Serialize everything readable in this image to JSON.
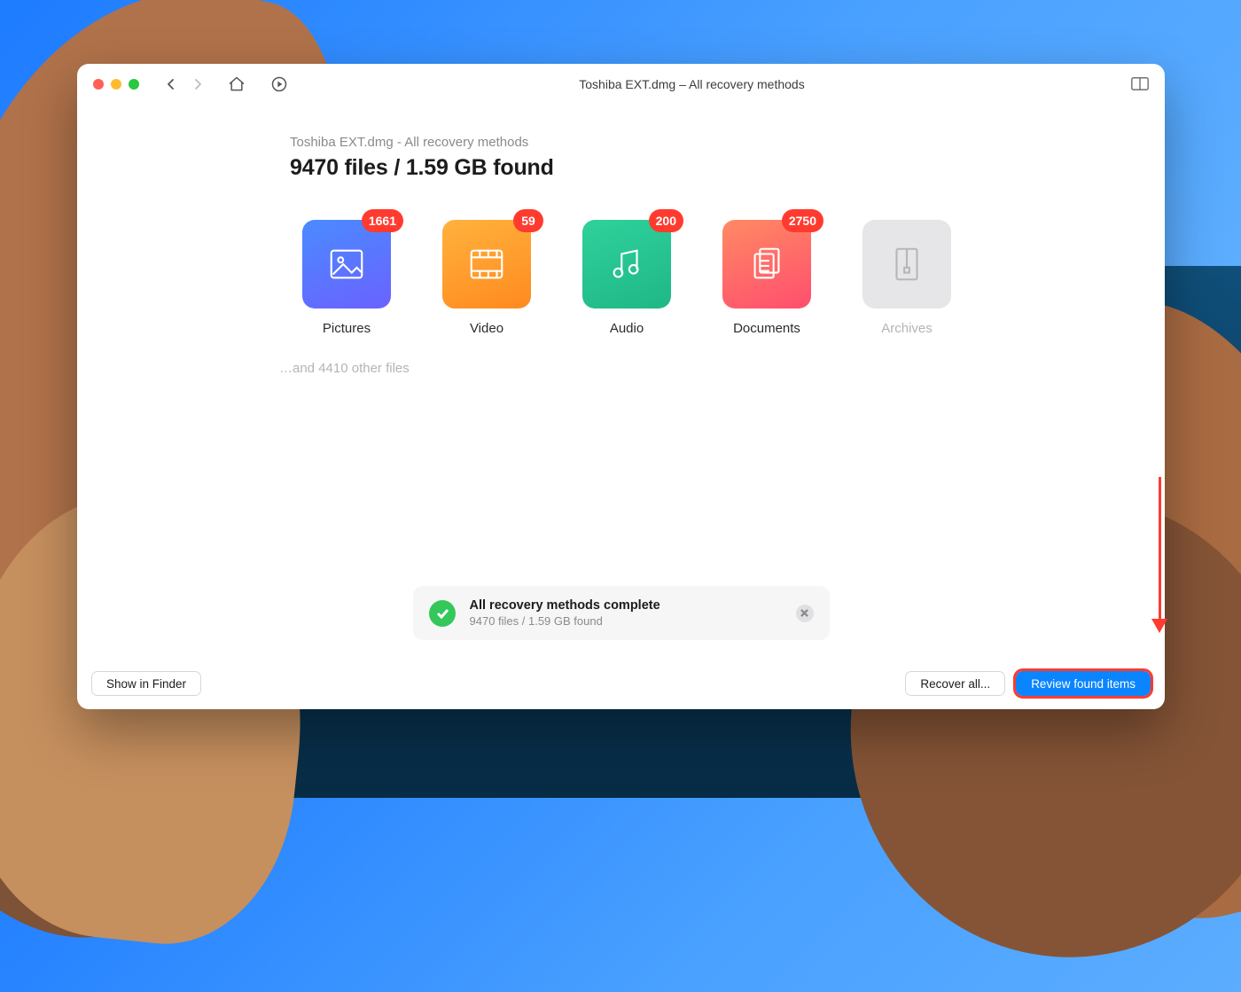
{
  "window": {
    "title": "Toshiba EXT.dmg – All recovery methods"
  },
  "summary": {
    "subtitle": "Toshiba EXT.dmg - All recovery methods",
    "headline": "9470 files / 1.59 GB found",
    "other_files": "…and 4410 other files"
  },
  "categories": [
    {
      "key": "pictures",
      "label": "Pictures",
      "count": "1661"
    },
    {
      "key": "video",
      "label": "Video",
      "count": "59"
    },
    {
      "key": "audio",
      "label": "Audio",
      "count": "200"
    },
    {
      "key": "documents",
      "label": "Documents",
      "count": "2750"
    },
    {
      "key": "archives",
      "label": "Archives",
      "count": ""
    }
  ],
  "status": {
    "title": "All recovery methods complete",
    "detail": "9470 files / 1.59 GB found"
  },
  "footer": {
    "show_in_finder": "Show in Finder",
    "recover_all": "Recover all...",
    "review": "Review found items"
  }
}
